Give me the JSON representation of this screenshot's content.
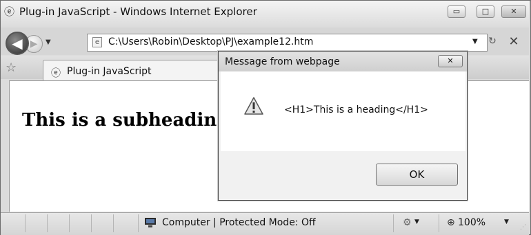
{
  "window": {
    "title": "Plug-in JavaScript - Windows Internet Explorer",
    "caption_buttons": {
      "minimize": "▭",
      "maximize": "□",
      "close": "✕"
    }
  },
  "navigation": {
    "back_glyph": "◀",
    "forward_glyph": "▶",
    "dropdown_glyph": "▼",
    "address": "C:\\Users\\Robin\\Desktop\\PJ\\example12.htm",
    "refresh_glyph": "↻",
    "stop_glyph": "✕"
  },
  "tabs": {
    "favorites_glyph": "☆",
    "active_tab": "Plug-in JavaScript"
  },
  "content": {
    "subheading": "This is a subheading"
  },
  "status_bar": {
    "zone_text": "Computer | Protected Mode: Off",
    "zoom": "100%",
    "dropdown_glyph": "▼"
  },
  "dialog": {
    "title": "Message from webpage",
    "message": "<H1>This is a heading</H1>",
    "ok_label": "OK",
    "close_glyph": "✕"
  },
  "icons": [
    "ie-icon",
    "page-icon",
    "warning-icon",
    "computer-icon",
    "security-icon",
    "zoom-icon"
  ]
}
